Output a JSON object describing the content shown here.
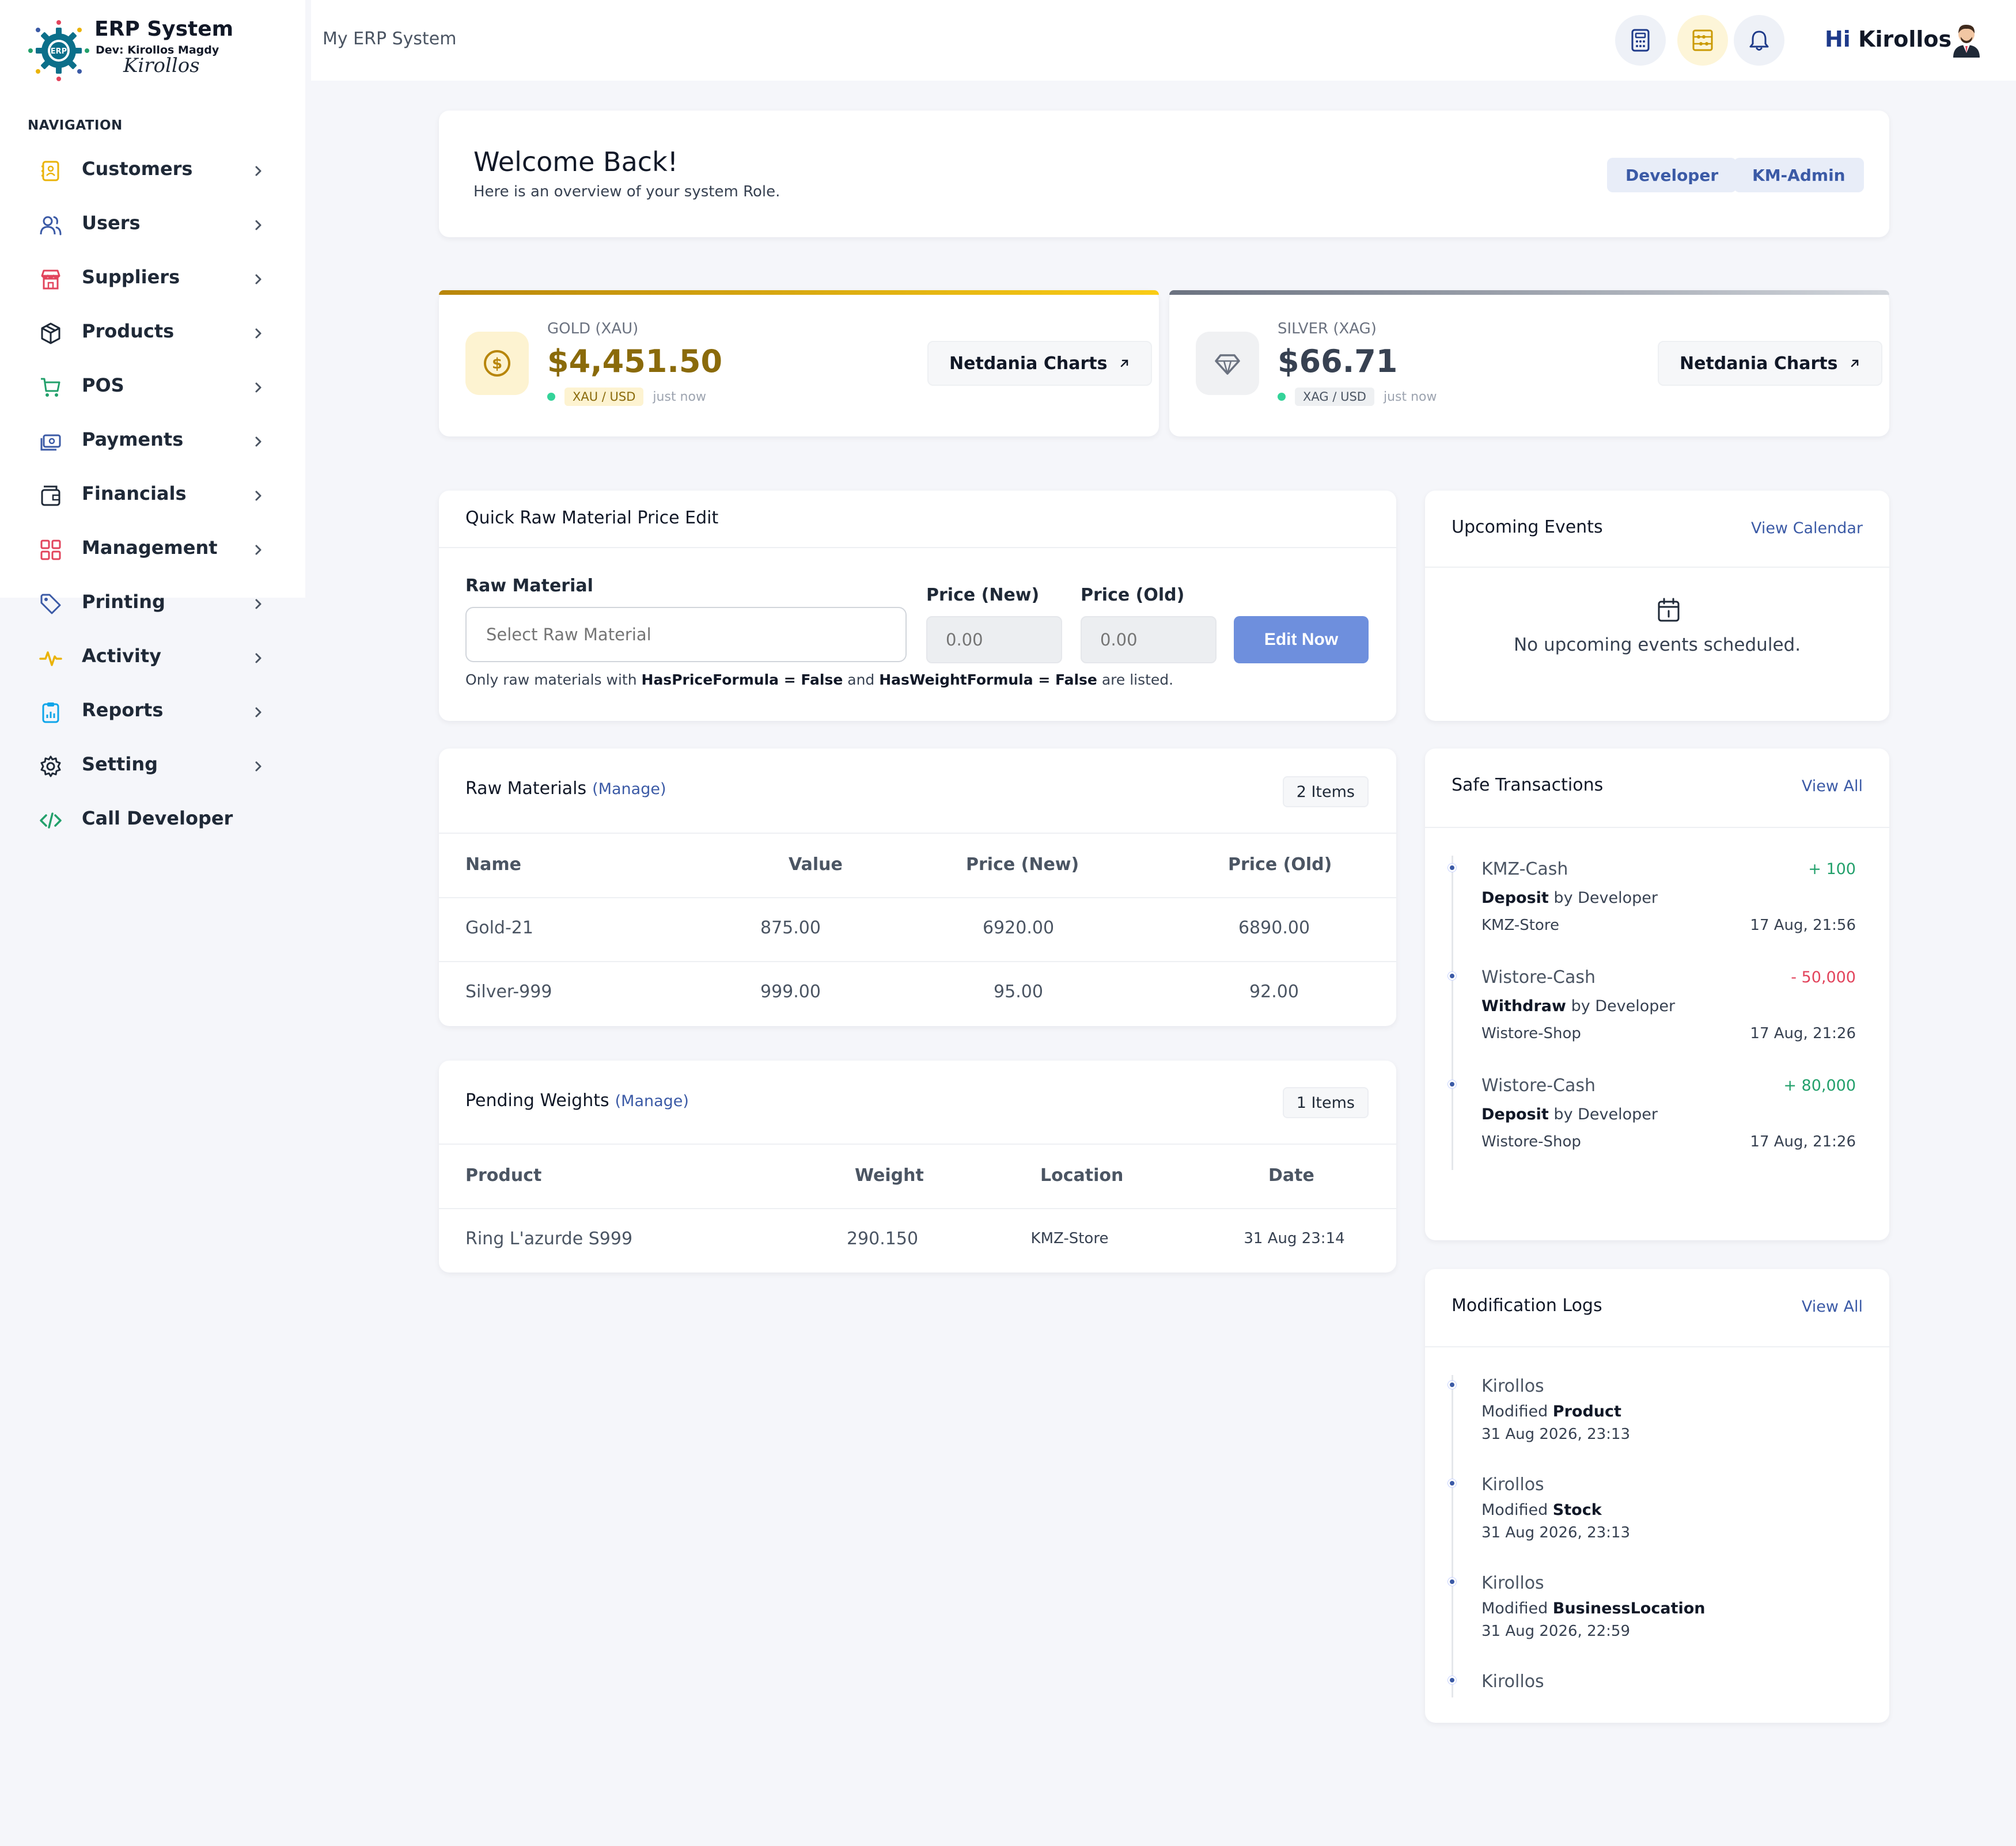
{
  "brand": {
    "title": "ERP System",
    "developer": "Dev: Kirollos Magdy",
    "signature": "Kirollos",
    "logo_text": "ERP"
  },
  "nav": {
    "heading": "NAVIGATION",
    "items": [
      {
        "label": "Customers",
        "icon": "contacts-icon",
        "color": "#eab308",
        "chevron": true
      },
      {
        "label": "Users",
        "icon": "users-icon",
        "color": "#3b5aa6",
        "chevron": true
      },
      {
        "label": "Suppliers",
        "icon": "store-icon",
        "color": "#e2445c",
        "chevron": true
      },
      {
        "label": "Products",
        "icon": "box-icon",
        "color": "#1f2937",
        "chevron": true
      },
      {
        "label": "POS",
        "icon": "cart-icon",
        "color": "#22a06b",
        "chevron": true
      },
      {
        "label": "Payments",
        "icon": "cash-icon",
        "color": "#3b5aa6",
        "chevron": true
      },
      {
        "label": "Financials",
        "icon": "wallet-icon",
        "color": "#1f2937",
        "chevron": true
      },
      {
        "label": "Management",
        "icon": "grid-icon",
        "color": "#e2445c",
        "chevron": true
      },
      {
        "label": "Printing",
        "icon": "tag-icon",
        "color": "#3b5aa6",
        "chevron": true
      },
      {
        "label": "Activity",
        "icon": "pulse-icon",
        "color": "#eab308",
        "chevron": true
      },
      {
        "label": "Reports",
        "icon": "clipboard-icon",
        "color": "#0ea5e9",
        "chevron": true
      },
      {
        "label": "Setting",
        "icon": "gear-icon",
        "color": "#1f2937",
        "chevron": true
      },
      {
        "label": "Call Developer",
        "icon": "code-icon",
        "color": "#22a06b",
        "chevron": false
      }
    ]
  },
  "header": {
    "breadcrumb": "My ERP System",
    "greeting_hi": "Hi",
    "greeting_name": "Kirollos",
    "buttons": [
      {
        "icon": "calculator-icon",
        "bg": "#eef1f7",
        "color": "#1e3a8a"
      },
      {
        "icon": "abacus-icon",
        "bg": "#fdf5d8",
        "color": "#ca9a04"
      },
      {
        "icon": "bell-icon",
        "bg": "#eef1f7",
        "color": "#1e3a8a"
      }
    ]
  },
  "welcome": {
    "title": "Welcome Back!",
    "subtitle": "Here is an overview of your system Role.",
    "roles": [
      "Developer",
      "KM-Admin"
    ]
  },
  "metals": [
    {
      "label": "GOLD (XAU)",
      "price": "$4,451.50",
      "pair": "XAU / USD",
      "updated": "just now",
      "button": "Netdania Charts",
      "accent": "#ca9a04",
      "price_color": "#8a6a0a",
      "icon": "dollar-coin-icon"
    },
    {
      "label": "SILVER (XAG)",
      "price": "$66.71",
      "pair": "XAG / USD",
      "updated": "just now",
      "button": "Netdania Charts",
      "accent": "#6b7280",
      "price_color": "#374151",
      "icon": "diamond-icon"
    }
  ],
  "quick_edit": {
    "title": "Quick Raw Material Price Edit",
    "raw_label": "Raw Material",
    "raw_placeholder": "Select Raw Material",
    "new_label": "Price (New)",
    "old_label": "Price (Old)",
    "new_placeholder": "0.00",
    "old_placeholder": "0.00",
    "button": "Edit Now",
    "note_pre": "Only raw materials with ",
    "note_b1": "HasPriceFormula = False",
    "note_mid": " and ",
    "note_b2": "HasWeightFormula = False",
    "note_post": " are listed."
  },
  "raw_materials": {
    "title": "Raw Materials",
    "manage": "(Manage)",
    "count": "2 Items",
    "columns": [
      "Name",
      "Value",
      "Price (New)",
      "Price (Old)"
    ],
    "rows": [
      [
        "Gold-21",
        "875.00",
        "6920.00",
        "6890.00"
      ],
      [
        "Silver-999",
        "999.00",
        "95.00",
        "92.00"
      ]
    ]
  },
  "pending_weights": {
    "title": "Pending Weights",
    "manage": "(Manage)",
    "count": "1 Items",
    "columns": [
      "Product",
      "Weight",
      "Location",
      "Date"
    ],
    "rows": [
      [
        "Ring L'azurde S999",
        "290.150",
        "KMZ-Store",
        "31 Aug 23:14"
      ]
    ]
  },
  "events": {
    "title": "Upcoming Events",
    "link": "View Calendar",
    "empty": "No upcoming events scheduled."
  },
  "safe_transactions": {
    "title": "Safe Transactions",
    "link": "View All",
    "items": [
      {
        "safe": "KMZ-Cash",
        "amount": "+ 100",
        "type": "Deposit",
        "by": " by Developer",
        "store": "KMZ-Store",
        "date": "17 Aug, 21:56",
        "positive": true
      },
      {
        "safe": "Wistore-Cash",
        "amount": "- 50,000",
        "type": "Withdraw",
        "by": " by Developer",
        "store": "Wistore-Shop",
        "date": "17 Aug, 21:26",
        "positive": false
      },
      {
        "safe": "Wistore-Cash",
        "amount": "+ 80,000",
        "type": "Deposit",
        "by": " by Developer",
        "store": "Wistore-Shop",
        "date": "17 Aug, 21:26",
        "positive": true
      }
    ]
  },
  "modification_logs": {
    "title": "Modification Logs",
    "link": "View All",
    "items": [
      {
        "user": "Kirollos",
        "action": "Modified ",
        "entity": "Product",
        "date": "31 Aug 2026, 23:13"
      },
      {
        "user": "Kirollos",
        "action": "Modified ",
        "entity": "Stock",
        "date": "31 Aug 2026, 23:13"
      },
      {
        "user": "Kirollos",
        "action": "Modified ",
        "entity": "BusinessLocation",
        "date": "31 Aug 2026, 22:59"
      },
      {
        "user": "Kirollos"
      }
    ]
  }
}
